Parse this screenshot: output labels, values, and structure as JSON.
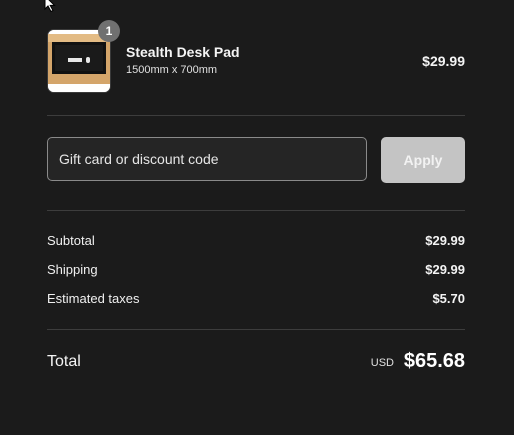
{
  "product": {
    "quantity": "1",
    "name": "Stealth Desk Pad",
    "variant": "1500mm x 700mm",
    "price": "$29.99"
  },
  "discount": {
    "placeholder": "Gift card or discount code",
    "value": "",
    "apply_label": "Apply"
  },
  "totals": {
    "lines": [
      {
        "label": "Subtotal",
        "value": "$29.99"
      },
      {
        "label": "Shipping",
        "value": "$29.99"
      },
      {
        "label": "Estimated taxes",
        "value": "$5.70"
      }
    ],
    "total_label": "Total",
    "currency": "USD",
    "total_amount": "$65.68"
  },
  "colors": {
    "background": "#1b1b1b",
    "apply_button": "#c4c4c4",
    "badge": "#707070",
    "divider": "#3d3d3d"
  }
}
